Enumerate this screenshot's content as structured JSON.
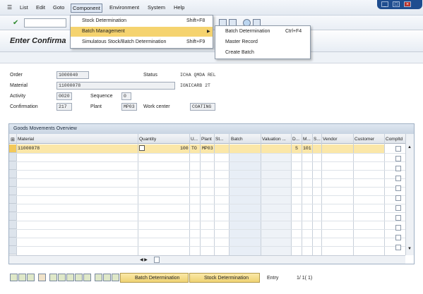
{
  "menubar": {
    "items": [
      "List",
      "Edit",
      "Goto",
      "Component",
      "Environment",
      "System",
      "Help"
    ]
  },
  "title": "Enter Confirma",
  "form": {
    "order_label": "Order",
    "order_value": "1000040",
    "status_label": "Status",
    "status_value": "ICHA QMDA REL",
    "material_label": "Material",
    "material_value": "11000078",
    "material_desc": "IGNICARB 2T",
    "activity_label": "Activity",
    "activity_value": "0020",
    "sequence_label": "Sequence",
    "sequence_value": "0",
    "confirmation_label": "Confirmation",
    "confirmation_value": "217",
    "plant_label": "Plant",
    "plant_value": "MP03",
    "workcenter_label": "Work center",
    "workcenter_value": "COATING"
  },
  "table": {
    "title": "Goods Movements Overview",
    "columns": [
      "Material",
      "Quantity",
      "U...",
      "Plant",
      "St...",
      "Batch",
      "Valuation ...",
      "D...",
      "M...",
      "S...",
      "Vendor",
      "Customer",
      "Compltd"
    ],
    "row1": {
      "material": "11000078",
      "quantity": "100",
      "unit": "TO",
      "plant": "MP03",
      "d": "S",
      "m": "101"
    }
  },
  "bottom": {
    "batch_btn": "Batch Determination",
    "stock_btn": "Stock Determination",
    "entry_label": "Entry",
    "entry_value": "1/ 1( 1)"
  },
  "menu1": {
    "items": [
      {
        "label": "Stock Determination",
        "shortcut": "Shift+F8"
      },
      {
        "label": "Batch Management",
        "shortcut": ""
      },
      {
        "label": "Simulatous Stock/Batch Determination",
        "shortcut": "Shift+F9"
      }
    ]
  },
  "menu2": {
    "items": [
      {
        "label": "Batch Determination",
        "shortcut": "Ctrl+F4"
      },
      {
        "label": "Master Record",
        "shortcut": ""
      },
      {
        "label": "Create Batch",
        "shortcut": ""
      }
    ]
  },
  "colors": {
    "highlight": "#f5d36f",
    "row_selected": "#fbe7a8",
    "brand": "#1f4d8f"
  }
}
